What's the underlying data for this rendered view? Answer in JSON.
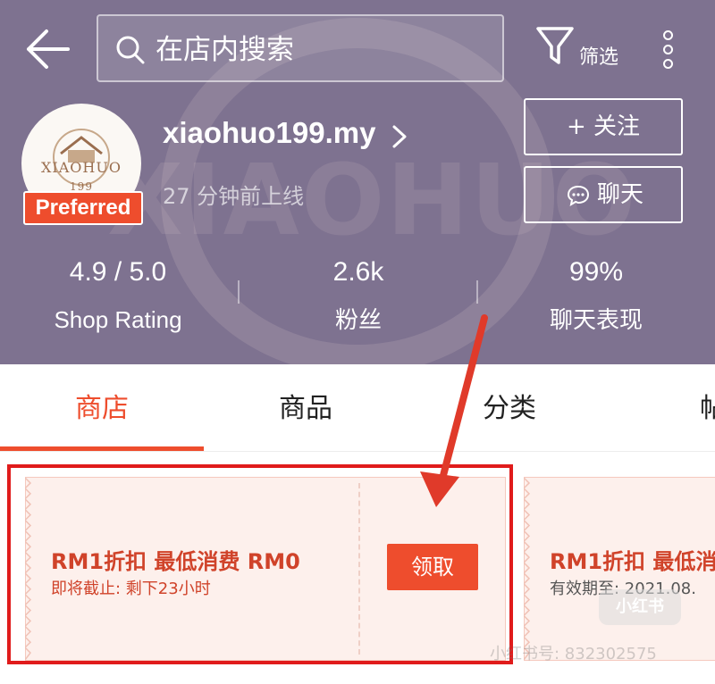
{
  "header": {
    "search_placeholder": "在店内搜索",
    "filter_label": "筛选"
  },
  "shop": {
    "avatar_text": "XIAOHUO",
    "avatar_subtext": "199",
    "watermark_text": "XIAOHUO",
    "badge": "Preferred",
    "name": "xiaohuo199.my",
    "online_status": "27 分钟前上线",
    "follow_label": "+ 关注",
    "chat_label": "聊天"
  },
  "stats": [
    {
      "value": "4.9 / 5.0",
      "label": "Shop Rating"
    },
    {
      "value": "2.6k",
      "label": "粉丝"
    },
    {
      "value": "99%",
      "label": "聊天表现"
    }
  ],
  "tabs": [
    {
      "label": "商店",
      "active": true
    },
    {
      "label": "商品",
      "active": false
    },
    {
      "label": "分类",
      "active": false
    },
    {
      "label": "帖",
      "active": false
    }
  ],
  "coupons": [
    {
      "title": "RM1折扣 最低消费 RM0",
      "subtitle": "即将截止: 剩下23小时",
      "button": "领取"
    },
    {
      "title": "RM1折扣 最低消",
      "subtitle": "有效期至: 2021.08."
    }
  ],
  "watermark": {
    "logo": "小红书",
    "id": "小红书号: 832302575"
  },
  "colors": {
    "brand": "#ee4d2d",
    "header_bg": "#7e7290",
    "annotation_red": "#e01b1b"
  }
}
